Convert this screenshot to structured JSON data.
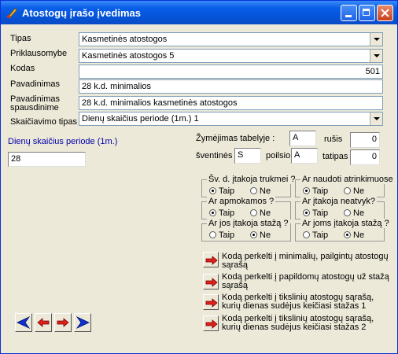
{
  "window": {
    "title": "Atostogų įrašo įvedimas"
  },
  "form": {
    "tipas": {
      "label": "Tipas",
      "value": "Kasmetinės atostogos"
    },
    "priklausomybe": {
      "label": "Priklausomybe",
      "value": "Kasmetinės atostogos 5"
    },
    "kodas": {
      "label": "Kodas",
      "value": "501"
    },
    "pavadinimas": {
      "label": "Pavadinimas",
      "value": "28 k.d. minimalios"
    },
    "pavadinimas_spausdinime": {
      "label_line1": "Pavadinimas",
      "label_line2": "spausdinime",
      "value": "28 k.d. minimalios kasmetinės atostogos"
    },
    "skaiciavimo_tipas": {
      "label": "Skaičiavimo tipas",
      "value": "Dienų skaičius periode (1m.) 1"
    }
  },
  "days": {
    "label": "Dienų skaičius periode (1m.)",
    "value": "28"
  },
  "tabel": {
    "label": "Žymėjimas tabelyje :",
    "code_value": "A",
    "rusis_label": "rušis",
    "rusis_value": "0",
    "sventines_label": "šventinės",
    "sventines_value": "S",
    "poilsio_label": "poilsio",
    "poilsio_value": "A",
    "tatipas_label": "tatipas",
    "tatipas_value": "0"
  },
  "groups": {
    "sv_d": {
      "title": "Šv. d. įtakoja trukmei ?",
      "yes": "Taip",
      "no": "Ne",
      "selected": "yes"
    },
    "atrinkimuose": {
      "title": "Ar naudoti atrinkimuose",
      "yes": "Taip",
      "no": "Ne",
      "selected": "yes"
    },
    "apmokamos": {
      "title": "Ar apmokamos ?",
      "yes": "Taip",
      "no": "Ne",
      "selected": "yes"
    },
    "neatvyk": {
      "title": "Ar įtakoja neatvyk?",
      "yes": "Taip",
      "no": "Ne",
      "selected": "yes"
    },
    "jos_staz": {
      "title": "Ar jos įtakoja stažą ?",
      "yes": "Taip",
      "no": "Ne",
      "selected": "no"
    },
    "joms_staz": {
      "title": "Ar joms įtakoja stažą ?",
      "yes": "Taip",
      "no": "Ne",
      "selected": "no"
    }
  },
  "actions": [
    {
      "line1": "Kodą perkelti į minimalių, pailgintų atostogų",
      "line2": "sąrašą"
    },
    {
      "line1": "Kodą perkelti į papildomų atostogų už stažą",
      "line2": "sąrašą"
    },
    {
      "line1": "Kodą perkelti į tikslinių atostogų sąrašą,",
      "line2": "kurių dienas sudėjus keičiasi stažas 1"
    },
    {
      "line1": "Kodą perkelti į tikslinių atostogų sąrašą,",
      "line2": "kurių dienas sudėjus keičiasi stažas 2"
    }
  ],
  "nav_icons": [
    "first-icon",
    "prev-icon",
    "next-icon",
    "last-icon"
  ],
  "colors": {
    "title_bar": "#0553d8",
    "accent_red": "#e0201a",
    "nav_blue": "#1030d0",
    "days_label": "#0000a8"
  }
}
